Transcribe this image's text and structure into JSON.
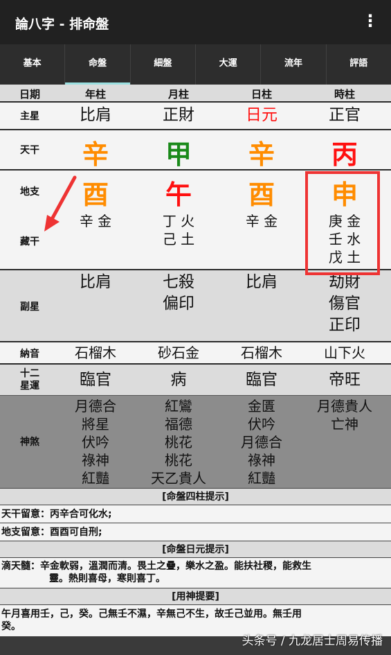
{
  "app": {
    "title": "論八字 - 排命盤",
    "menu_icon": "more-vert-icon"
  },
  "tabs": [
    "基本",
    "命盤",
    "細盤",
    "大運",
    "流年",
    "評語"
  ],
  "columns": {
    "label": "日期",
    "pillars": [
      "年柱",
      "月柱",
      "日柱",
      "時柱"
    ]
  },
  "main_star": {
    "label": "主星",
    "values": [
      "比肩",
      "正財",
      "日元",
      "正官"
    ]
  },
  "heavenly_stem": {
    "label": "天干",
    "values": [
      "辛",
      "甲",
      "辛",
      "丙"
    ],
    "colors": [
      "#ff8c00",
      "#1a8a1a",
      "#ff8c00",
      "#ff1010"
    ]
  },
  "earthly_branch": {
    "label": "地支",
    "values": [
      "酉",
      "午",
      "酉",
      "申"
    ],
    "colors": [
      "#ff8c00",
      "#ff1010",
      "#ff8c00",
      "#ff8c00"
    ]
  },
  "hidden_stems": {
    "label": "藏干",
    "values": [
      [
        "辛 金"
      ],
      [
        "丁 火",
        "己 土"
      ],
      [
        "辛 金"
      ],
      [
        "庚 金",
        "壬 水",
        "戊 土"
      ]
    ]
  },
  "sub_star": {
    "label": "副星",
    "values": [
      [
        "比肩"
      ],
      [
        "七殺",
        "偏印"
      ],
      [
        "比肩"
      ],
      [
        "劫財",
        "傷官",
        "正印"
      ]
    ]
  },
  "nayin": {
    "label": "納音",
    "values": [
      "石榴木",
      "砂石金",
      "石榴木",
      "山下火"
    ]
  },
  "twelve_stages": {
    "label_line1": "十二",
    "label_line2": "星運",
    "values": [
      "臨官",
      "病",
      "臨官",
      "帝旺"
    ]
  },
  "spirits": {
    "label": "神煞",
    "values": [
      [
        "月德合",
        "將星",
        "伏吟",
        "祿神",
        "紅豔"
      ],
      [
        "紅鸞",
        "福德",
        "桃花",
        "桃花",
        "天乙貴人"
      ],
      [
        "金匱",
        "伏吟",
        "月德合",
        "祿神",
        "紅豔"
      ],
      [
        "月德貴人",
        "亡神"
      ]
    ]
  },
  "notes": {
    "four_pillars_header": "[命盤四柱提示]",
    "stem_note": "天干留意：丙辛合可化水;",
    "branch_note": "地支留意：酉酉可自刑;",
    "day_master_header": "[命盤日元提示]",
    "ditiansui_line1": "滴天髓：辛金軟弱，溫潤而清。畏土之疊，樂水之盈。能扶社稷，能救生",
    "ditiansui_line2": "靈。熱則喜母，寒則喜丁。",
    "yongshen_header": "[用神提要]",
    "yongshen_line1": "午月喜用壬，己，癸。己無壬不濕，辛無己不生，故壬己並用。無壬用",
    "yongshen_line2": "癸。"
  },
  "watermark": "头条号 / 九龙居士周易传播"
}
